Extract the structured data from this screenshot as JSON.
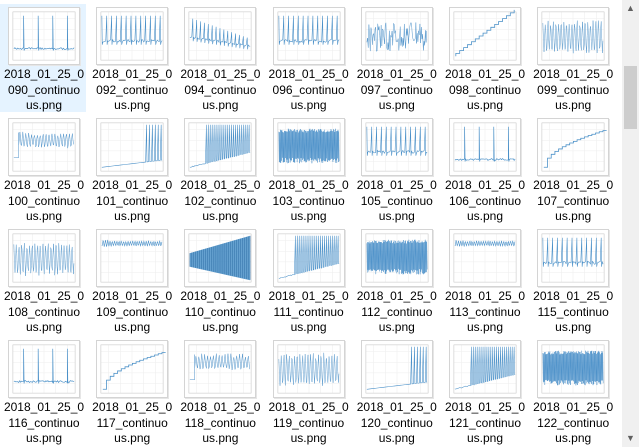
{
  "files": [
    {
      "name": "2018_01_25_0090_continuous.png",
      "line1": "2018_01_25_0",
      "line2": "090_continuo",
      "line3": "us.png",
      "selected": true,
      "pattern": "spikes-sparse"
    },
    {
      "name": "2018_01_25_0092_continuous.png",
      "line1": "2018_01_25_0",
      "line2": "092_continuo",
      "line3": "us.png",
      "selected": false,
      "pattern": "spikes-regular"
    },
    {
      "name": "2018_01_25_0094_continuous.png",
      "line1": "2018_01_25_0",
      "line2": "094_continuo",
      "line3": "us.png",
      "selected": false,
      "pattern": "spikes-decay"
    },
    {
      "name": "2018_01_25_0096_continuous.png",
      "line1": "2018_01_25_0",
      "line2": "096_continuo",
      "line3": "us.png",
      "selected": false,
      "pattern": "spikes-regular"
    },
    {
      "name": "2018_01_25_0097_continuous.png",
      "line1": "2018_01_25_0",
      "line2": "097_continuo",
      "line3": "us.png",
      "selected": false,
      "pattern": "noise"
    },
    {
      "name": "2018_01_25_0098_continuous.png",
      "line1": "2018_01_25_0",
      "line2": "098_continuo",
      "line3": "us.png",
      "selected": false,
      "pattern": "staircase"
    },
    {
      "name": "2018_01_25_0099_continuous.png",
      "line1": "2018_01_25_0",
      "line2": "099_continuo",
      "line3": "us.png",
      "selected": false,
      "pattern": "dense-band"
    },
    {
      "name": "2018_01_25_0100_continuous.png",
      "line1": "2018_01_25_0",
      "line2": "100_continuo",
      "line3": "us.png",
      "selected": false,
      "pattern": "step-then-band"
    },
    {
      "name": "2018_01_25_0101_continuous.png",
      "line1": "2018_01_25_0",
      "line2": "101_continuo",
      "line3": "us.png",
      "selected": false,
      "pattern": "ramp-spikes"
    },
    {
      "name": "2018_01_25_0102_continuous.png",
      "line1": "2018_01_25_0",
      "line2": "102_continuo",
      "line3": "us.png",
      "selected": false,
      "pattern": "growing-spikes"
    },
    {
      "name": "2018_01_25_0103_continuous.png",
      "line1": "2018_01_25_0",
      "line2": "103_continuo",
      "line3": "us.png",
      "selected": false,
      "pattern": "dense-spikes"
    },
    {
      "name": "2018_01_25_0105_continuous.png",
      "line1": "2018_01_25_0",
      "line2": "105_continuo",
      "line3": "us.png",
      "selected": false,
      "pattern": "spikes-regular"
    },
    {
      "name": "2018_01_25_0106_continuous.png",
      "line1": "2018_01_25_0",
      "line2": "106_continuo",
      "line3": "us.png",
      "selected": false,
      "pattern": "spikes-sparse"
    },
    {
      "name": "2018_01_25_0107_continuous.png",
      "line1": "2018_01_25_0",
      "line2": "107_continuo",
      "line3": "us.png",
      "selected": false,
      "pattern": "staircase-curve"
    },
    {
      "name": "2018_01_25_0108_continuous.png",
      "line1": "2018_01_25_0",
      "line2": "108_continuo",
      "line3": "us.png",
      "selected": false,
      "pattern": "dense-band"
    },
    {
      "name": "2018_01_25_0109_continuous.png",
      "line1": "2018_01_25_0",
      "line2": "109_continuo",
      "line3": "us.png",
      "selected": false,
      "pattern": "flat-band"
    },
    {
      "name": "2018_01_25_0110_continuous.png",
      "line1": "2018_01_25_0",
      "line2": "110_continuo",
      "line3": "us.png",
      "selected": false,
      "pattern": "filled-wedge"
    },
    {
      "name": "2018_01_25_0111_continuous.png",
      "line1": "2018_01_25_0",
      "line2": "111_continuo",
      "line3": "us.png",
      "selected": false,
      "pattern": "growing-spikes"
    },
    {
      "name": "2018_01_25_0112_continuous.png",
      "line1": "2018_01_25_0",
      "line2": "112_continuo",
      "line3": "us.png",
      "selected": false,
      "pattern": "dense-spikes"
    },
    {
      "name": "2018_01_25_0113_continuous.png",
      "line1": "2018_01_25_0",
      "line2": "113_continuo",
      "line3": "us.png",
      "selected": false,
      "pattern": "flat-band"
    },
    {
      "name": "2018_01_25_0115_continuous.png",
      "line1": "2018_01_25_0",
      "line2": "115_continuo",
      "line3": "us.png",
      "selected": false,
      "pattern": "spikes-regular"
    },
    {
      "name": "2018_01_25_0116_continuous.png",
      "line1": "2018_01_25_0",
      "line2": "116_continuo",
      "line3": "us.png",
      "selected": false,
      "pattern": "spikes-sparse"
    },
    {
      "name": "2018_01_25_0117_continuous.png",
      "line1": "2018_01_25_0",
      "line2": "117_continuo",
      "line3": "us.png",
      "selected": false,
      "pattern": "staircase-curve"
    },
    {
      "name": "2018_01_25_0118_continuous.png",
      "line1": "2018_01_25_0",
      "line2": "118_continuo",
      "line3": "us.png",
      "selected": false,
      "pattern": "step-then-band"
    },
    {
      "name": "2018_01_25_0119_continuous.png",
      "line1": "2018_01_25_0",
      "line2": "119_continuo",
      "line3": "us.png",
      "selected": false,
      "pattern": "dense-band"
    },
    {
      "name": "2018_01_25_0120_continuous.png",
      "line1": "2018_01_25_0",
      "line2": "120_continuo",
      "line3": "us.png",
      "selected": false,
      "pattern": "ramp-spikes"
    },
    {
      "name": "2018_01_25_0121_continuous.png",
      "line1": "2018_01_25_0",
      "line2": "121_continuo",
      "line3": "us.png",
      "selected": false,
      "pattern": "growing-spikes"
    },
    {
      "name": "2018_01_25_0122_continuous.png",
      "line1": "2018_01_25_0",
      "line2": "122_continuo",
      "line3": "us.png",
      "selected": false,
      "pattern": "dense-spikes"
    }
  ],
  "theme": {
    "plot_color": "#4a90c8",
    "selection_color": "#e5f3ff",
    "scroll_thumb_color": "#cdcdcd"
  },
  "scrollbar": {
    "up_icon": "chevron-up-icon",
    "down_icon": "chevron-down-icon"
  }
}
